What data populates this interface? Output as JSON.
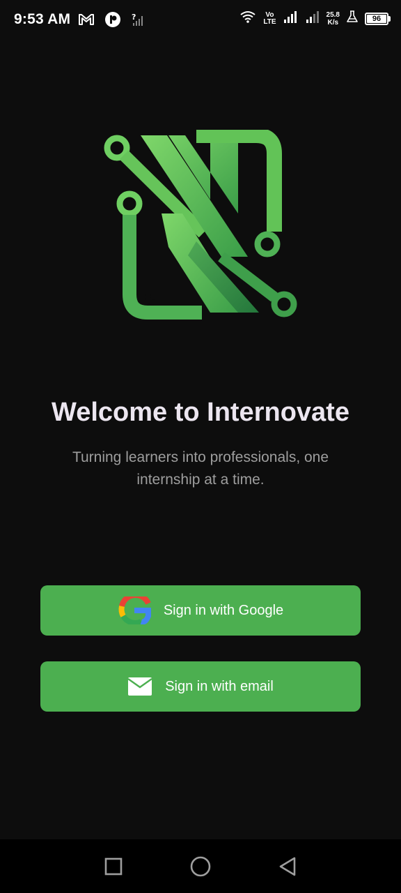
{
  "status_bar": {
    "time": "9:53 AM",
    "volte_top": "Vo",
    "volte_bottom": "LTE",
    "net_speed_value": "25.8",
    "net_speed_unit": "K/s",
    "battery_level": "96",
    "icons": [
      "gmail-icon",
      "app-notification-icon",
      "no-sim-signal-icon",
      "wifi-icon",
      "signal-icon",
      "signal-2-icon",
      "flask-icon",
      "battery-icon"
    ]
  },
  "logo": {
    "name": "Internovate logo",
    "accent_color": "#5cb85c"
  },
  "welcome": {
    "title": "Welcome to Internovate",
    "tagline": "Turning learners into professionals, one internship at a time."
  },
  "buttons": {
    "google_label": "Sign in with Google",
    "email_label": "Sign in with email",
    "color": "#4caf50"
  },
  "nav": {
    "items": [
      "recents-button",
      "home-button",
      "back-button"
    ]
  }
}
